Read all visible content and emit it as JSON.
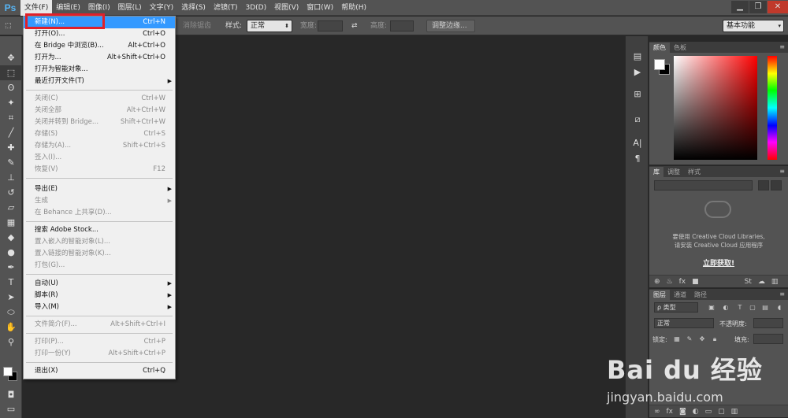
{
  "app": {
    "logo": "Ps"
  },
  "menubar": {
    "items": [
      "文件(F)",
      "编辑(E)",
      "图像(I)",
      "图层(L)",
      "文字(Y)",
      "选择(S)",
      "滤镜(T)",
      "3D(D)",
      "视图(V)",
      "窗口(W)",
      "帮助(H)"
    ]
  },
  "window": {
    "minimize": "▁",
    "restore": "❐",
    "close": "✕"
  },
  "options": {
    "feather_btn": "消除锯齿",
    "style_label": "样式:",
    "style_value": "正常",
    "width_label": "宽度:",
    "height_label": "高度:",
    "refine_btn": "调整边缘...",
    "workspace": "基本功能"
  },
  "file_menu": [
    {
      "label": "新建(N)...",
      "shortcut": "Ctrl+N",
      "state": "highlight"
    },
    {
      "label": "打开(O)...",
      "shortcut": "Ctrl+O",
      "state": "normal"
    },
    {
      "label": "在 Bridge 中浏览(B)...",
      "shortcut": "Alt+Ctrl+O",
      "state": "normal"
    },
    {
      "label": "打开为...",
      "shortcut": "Alt+Shift+Ctrl+O",
      "state": "normal"
    },
    {
      "label": "打开为智能对象...",
      "shortcut": "",
      "state": "normal"
    },
    {
      "label": "最近打开文件(T)",
      "shortcut": "",
      "state": "submenu"
    },
    {
      "label": "关闭(C)",
      "shortcut": "Ctrl+W",
      "state": "disabled"
    },
    {
      "label": "关闭全部",
      "shortcut": "Alt+Ctrl+W",
      "state": "disabled"
    },
    {
      "label": "关闭并转到 Bridge...",
      "shortcut": "Shift+Ctrl+W",
      "state": "disabled"
    },
    {
      "label": "存储(S)",
      "shortcut": "Ctrl+S",
      "state": "disabled"
    },
    {
      "label": "存储为(A)...",
      "shortcut": "Shift+Ctrl+S",
      "state": "disabled"
    },
    {
      "label": "签入(I)...",
      "shortcut": "",
      "state": "disabled"
    },
    {
      "label": "恢复(V)",
      "shortcut": "F12",
      "state": "disabled"
    },
    {
      "label": "导出(E)",
      "shortcut": "",
      "state": "submenu"
    },
    {
      "label": "生成",
      "shortcut": "",
      "state": "disabled-submenu"
    },
    {
      "label": "在 Behance 上共享(D)...",
      "shortcut": "",
      "state": "disabled"
    },
    {
      "label": "搜索 Adobe Stock...",
      "shortcut": "",
      "state": "normal"
    },
    {
      "label": "置入嵌入的智能对象(L)...",
      "shortcut": "",
      "state": "disabled"
    },
    {
      "label": "置入链接的智能对象(K)...",
      "shortcut": "",
      "state": "disabled"
    },
    {
      "label": "打包(G)...",
      "shortcut": "",
      "state": "disabled"
    },
    {
      "label": "自动(U)",
      "shortcut": "",
      "state": "submenu"
    },
    {
      "label": "脚本(R)",
      "shortcut": "",
      "state": "submenu"
    },
    {
      "label": "导入(M)",
      "shortcut": "",
      "state": "submenu"
    },
    {
      "label": "文件简介(F)...",
      "shortcut": "Alt+Shift+Ctrl+I",
      "state": "disabled"
    },
    {
      "label": "打印(P)...",
      "shortcut": "Ctrl+P",
      "state": "disabled"
    },
    {
      "label": "打印一份(Y)",
      "shortcut": "Alt+Shift+Ctrl+P",
      "state": "disabled"
    },
    {
      "label": "退出(X)",
      "shortcut": "Ctrl+Q",
      "state": "normal"
    }
  ],
  "color_panel": {
    "tabs": [
      "颜色",
      "色板"
    ]
  },
  "library_panel": {
    "tabs": [
      "库",
      "调整",
      "样式"
    ],
    "message_line1": "要使用 Creative Cloud Libraries,",
    "message_line2": "请安装 Creative Cloud 应用程序",
    "link": "立即获取!"
  },
  "layers_panel": {
    "tabs": [
      "图层",
      "通道",
      "路径"
    ],
    "kind_label": "ρ 类型",
    "blend_mode": "正常",
    "opacity_label": "不透明度:",
    "lock_label": "锁定:",
    "fill_label": "填充:"
  },
  "watermark": {
    "logo": "Bai du 经验",
    "url": "jingyan.baidu.com"
  }
}
